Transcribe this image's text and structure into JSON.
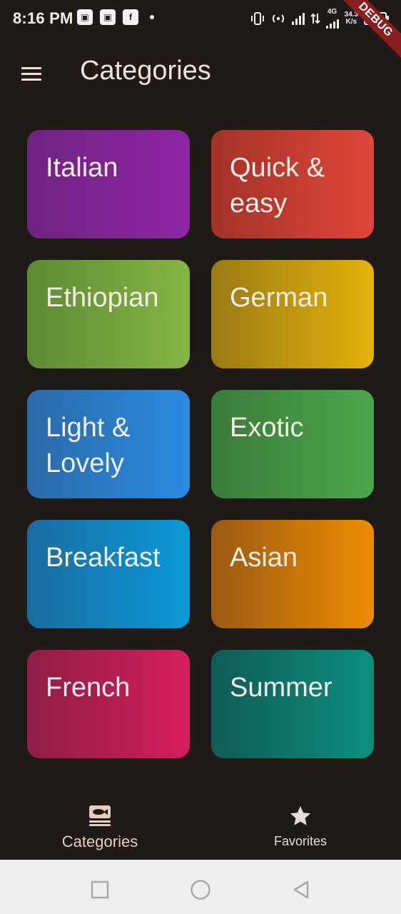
{
  "status_bar": {
    "time": "8:16 PM",
    "left_icons": [
      "app-badge-icon",
      "app-badge-icon",
      "facebook-icon",
      "dot-icon"
    ],
    "network_type": "4G",
    "speed_value": "34.3",
    "speed_unit": "K/s",
    "battery_level": "",
    "ribbon_text": "DEBUG"
  },
  "app_bar": {
    "title": "Categories",
    "menu_icon": "hamburger-menu-icon"
  },
  "categories": [
    {
      "label": "Italian",
      "color_start": "#6e2380",
      "color_end": "#8f25a6"
    },
    {
      "label": "Quick &\neasy",
      "color_start": "#a33229",
      "color_end": "#df4637"
    },
    {
      "label": "Ethiopian",
      "color_start": "#5d8a33",
      "color_end": "#86b545"
    },
    {
      "label": "German",
      "color_start": "#9a7b14",
      "color_end": "#e4b20a"
    },
    {
      "label": "Light &\nLovely",
      "color_start": "#2a6aa8",
      "color_end": "#2a8be0"
    },
    {
      "label": "Exotic",
      "color_start": "#3b7a3b",
      "color_end": "#4aa74b"
    },
    {
      "label": "Breakfast",
      "color_start": "#1b6b9e",
      "color_end": "#089ad8"
    },
    {
      "label": "Asian",
      "color_start": "#9a5a14",
      "color_end": "#ee8c00"
    },
    {
      "label": "French",
      "color_start": "#8e1e46",
      "color_end": "#d61d5e"
    },
    {
      "label": "Summer",
      "color_start": "#0f5b56",
      "color_end": "#0c8f7e"
    }
  ],
  "bottom_nav": {
    "items": [
      {
        "label": "Categories",
        "icon": "set-meal-icon",
        "selected": true
      },
      {
        "label": "Favorites",
        "icon": "star-icon",
        "selected": false
      }
    ]
  },
  "system_nav": {
    "buttons": [
      "recents-square-icon",
      "home-circle-icon",
      "back-triangle-icon"
    ]
  }
}
